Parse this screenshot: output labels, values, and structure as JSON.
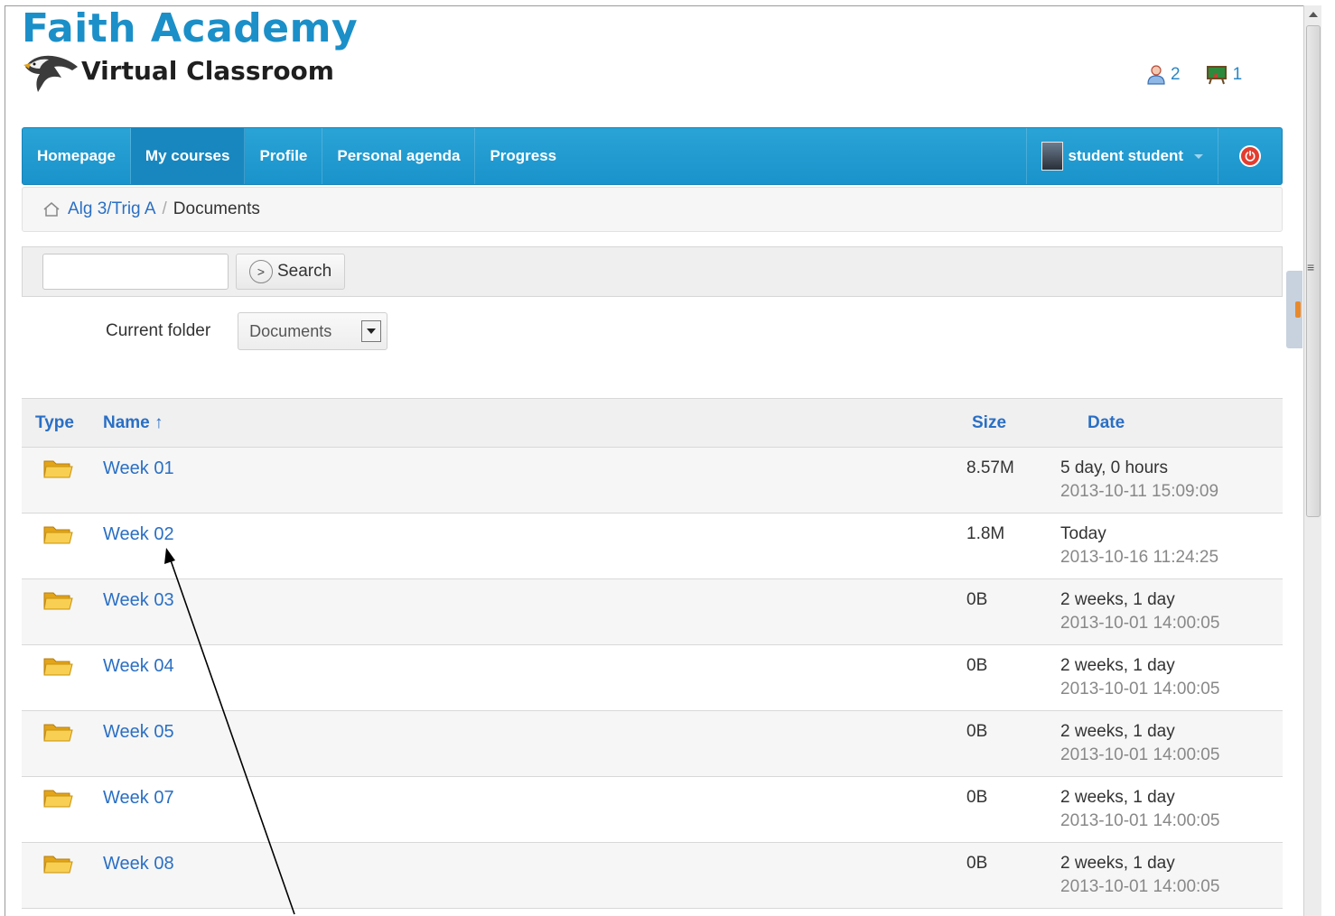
{
  "header": {
    "title": "Faith Academy",
    "subtitle": "Virtual Classroom",
    "users_count": "2",
    "messages_count": "1"
  },
  "nav": {
    "items": [
      {
        "label": "Homepage"
      },
      {
        "label": "My courses"
      },
      {
        "label": "Profile"
      },
      {
        "label": "Personal agenda"
      },
      {
        "label": "Progress"
      }
    ],
    "active": "My courses",
    "user_label": "student student"
  },
  "breadcrumb": {
    "course": "Alg 3/Trig A",
    "separator": "/",
    "current": "Documents"
  },
  "search": {
    "value": "",
    "button_label": "Search"
  },
  "folder": {
    "label": "Current folder",
    "selected": "Documents"
  },
  "table": {
    "headers": {
      "type": "Type",
      "name": "Name ↑",
      "size": "Size",
      "date": "Date"
    },
    "rows": [
      {
        "name": "Week 01",
        "size": "8.57M",
        "ago": "5 day, 0 hours",
        "timestamp": "2013-10-11 15:09:09"
      },
      {
        "name": "Week 02",
        "size": "1.8M",
        "ago": "Today",
        "timestamp": "2013-10-16 11:24:25"
      },
      {
        "name": "Week 03",
        "size": "0B",
        "ago": "2 weeks, 1 day",
        "timestamp": "2013-10-01 14:00:05"
      },
      {
        "name": "Week 04",
        "size": "0B",
        "ago": "2 weeks, 1 day",
        "timestamp": "2013-10-01 14:00:05"
      },
      {
        "name": "Week 05",
        "size": "0B",
        "ago": "2 weeks, 1 day",
        "timestamp": "2013-10-01 14:00:05"
      },
      {
        "name": "Week 07",
        "size": "0B",
        "ago": "2 weeks, 1 day",
        "timestamp": "2013-10-01 14:00:05"
      },
      {
        "name": "Week 08",
        "size": "0B",
        "ago": "2 weeks, 1 day",
        "timestamp": "2013-10-01 14:00:05"
      }
    ]
  },
  "icons": {
    "users": "user-icon",
    "messages": "chalkboard-icon",
    "logout": "power-icon",
    "home": "home-icon",
    "folder": "folder-icon"
  },
  "colors": {
    "brand": "#1b8fc8",
    "navbar": "#1993cb",
    "link": "#2a6fc4",
    "logout": "#e33d2f"
  }
}
